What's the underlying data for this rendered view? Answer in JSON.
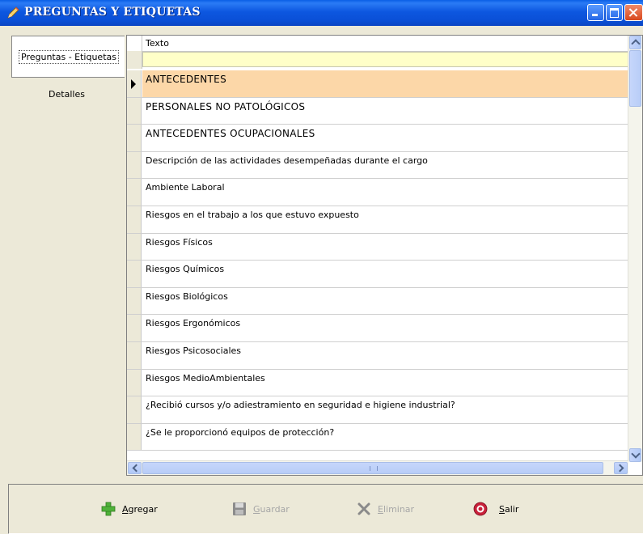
{
  "window": {
    "title": "PREGUNTAS Y ETIQUETAS"
  },
  "tabs": [
    {
      "label": "Preguntas - Etiquetas",
      "active": true
    },
    {
      "label": "Detalles",
      "active": false
    }
  ],
  "grid": {
    "column_header": "Texto",
    "filter_value": "",
    "rows": [
      "ANTECEDENTES",
      "PERSONALES NO PATOLÓGICOS",
      "ANTECEDENTES OCUPACIONALES",
      "Descripción de las actividades desempeñadas durante el cargo",
      "Ambiente Laboral",
      "Riesgos en el trabajo a los que estuvo expuesto",
      "Riesgos Físicos",
      "Riesgos Químicos",
      "Riesgos Biológicos",
      "Riesgos Ergonómicos",
      "Riesgos Psicosociales",
      "Riesgos MedioAmbientales",
      "¿Recibió cursos y/o adiestramiento en seguridad e higiene industrial?",
      "¿Se le proporcionó equipos de protección?"
    ],
    "selected_index": 0,
    "selected_color": "#fcd7a8",
    "filter_color": "#ffffc8"
  },
  "toolbar": {
    "add": {
      "first": "A",
      "rest": "gregar",
      "icon": "plus-icon",
      "enabled": true
    },
    "save": {
      "first": "G",
      "rest": "uardar",
      "icon": "floppy-disk-icon",
      "enabled": false
    },
    "delete": {
      "first": "E",
      "rest": "liminar",
      "icon": "x-delete-icon",
      "enabled": false
    },
    "exit": {
      "first": "S",
      "rest": "alir",
      "icon": "exit-icon",
      "enabled": true
    }
  }
}
